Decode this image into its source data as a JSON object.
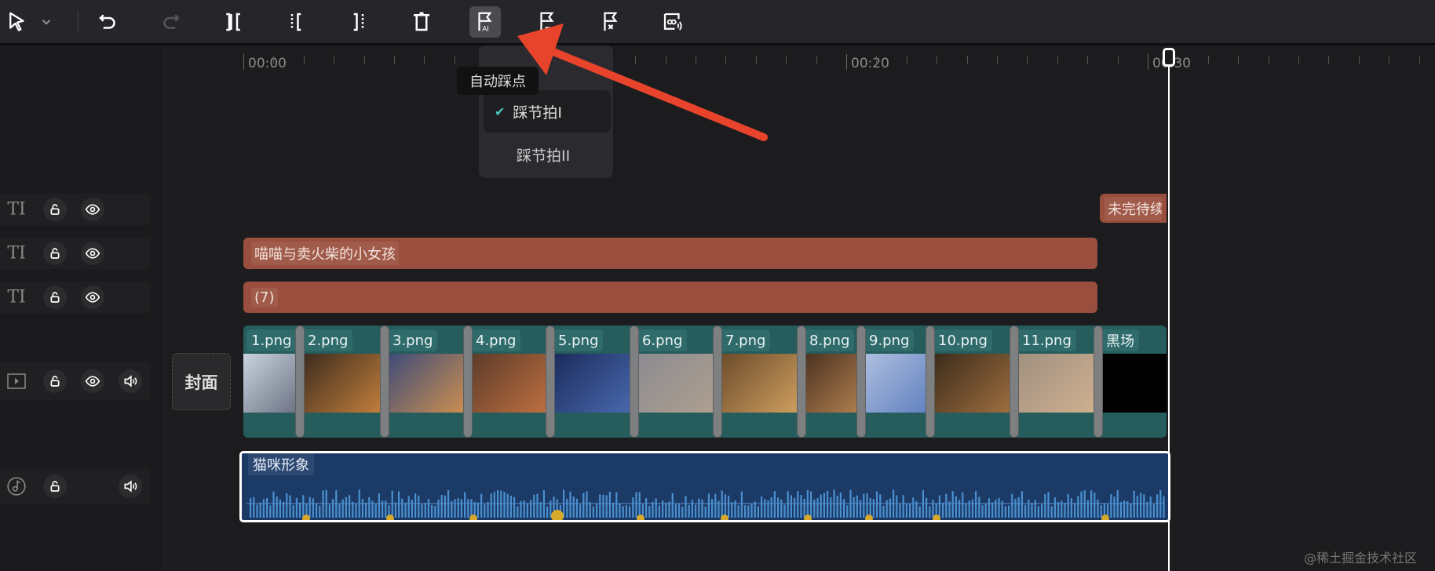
{
  "toolbar": {
    "tooltip": "自动踩点"
  },
  "dropdown": {
    "items": [
      {
        "label": "踩节拍I",
        "checked": true
      },
      {
        "label": "踩节拍II",
        "checked": false
      }
    ]
  },
  "ruler": {
    "labels": [
      "00:00",
      "00:20",
      "00:30"
    ]
  },
  "tracks": {
    "text1": {
      "clip": "未完待续"
    },
    "text2": {
      "clip": "喵喵与卖火柴的小女孩"
    },
    "text3": {
      "clip": "(7)"
    },
    "cover": "封面",
    "video": {
      "clips": [
        "1.png",
        "2.png",
        "3.png",
        "4.png",
        "5.png",
        "6.png",
        "7.png",
        "8.png",
        "9.png",
        "10.png",
        "11.png",
        "黑场"
      ]
    },
    "audio": {
      "clip": "猫咪形象"
    },
    "header_text": "TI"
  },
  "watermark": "@稀土掘金技术社区",
  "colors": {
    "text_clip": "#9a4f3e",
    "video_clip": "#265c5c",
    "audio_clip": "#1c3a66",
    "beat": "#d6a92a",
    "arrow": "#e8432b"
  }
}
